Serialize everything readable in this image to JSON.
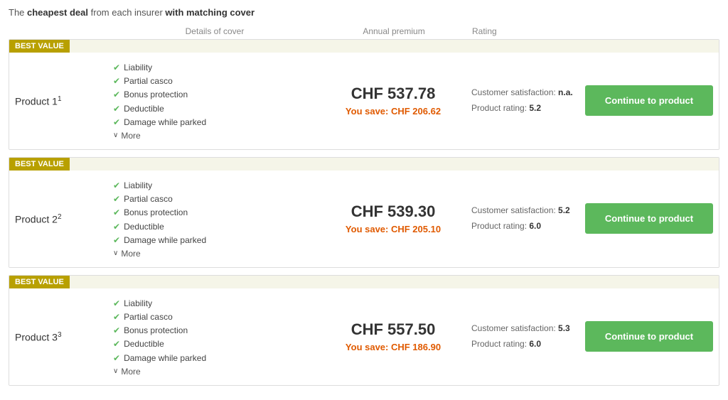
{
  "headline": {
    "prefix": "The ",
    "bold1": "cheapest deal",
    "middle": " from each insurer ",
    "bold2": "with matching cover"
  },
  "columns": {
    "details": "Details of cover",
    "premium": "Annual premium",
    "rating": "Rating"
  },
  "products": [
    {
      "id": "product-1",
      "name": "Product 1",
      "superscript": "1",
      "badge": "BEST VALUE",
      "features": [
        "Liability",
        "Partial casco",
        "Bonus protection",
        "Deductible",
        "Damage while parked"
      ],
      "more_label": "More",
      "premium": "CHF 537.78",
      "save": "You save: CHF 206.62",
      "customer_satisfaction_label": "Customer satisfaction:",
      "customer_satisfaction_value": "n.a.",
      "product_rating_label": "Product rating:",
      "product_rating_value": "5.2",
      "button_label": "Continue to product"
    },
    {
      "id": "product-2",
      "name": "Product 2",
      "superscript": "2",
      "badge": "BEST VALUE",
      "features": [
        "Liability",
        "Partial casco",
        "Bonus protection",
        "Deductible",
        "Damage while parked"
      ],
      "more_label": "More",
      "premium": "CHF 539.30",
      "save": "You save: CHF 205.10",
      "customer_satisfaction_label": "Customer satisfaction:",
      "customer_satisfaction_value": "5.2",
      "product_rating_label": "Product rating:",
      "product_rating_value": "6.0",
      "button_label": "Continue to product"
    },
    {
      "id": "product-3",
      "name": "Product 3",
      "superscript": "3",
      "badge": "BEST VALUE",
      "features": [
        "Liability",
        "Partial casco",
        "Bonus protection",
        "Deductible",
        "Damage while parked"
      ],
      "more_label": "More",
      "premium": "CHF 557.50",
      "save": "You save: CHF 186.90",
      "customer_satisfaction_label": "Customer satisfaction:",
      "customer_satisfaction_value": "5.3",
      "product_rating_label": "Product rating:",
      "product_rating_value": "6.0",
      "button_label": "Continue to product"
    }
  ]
}
